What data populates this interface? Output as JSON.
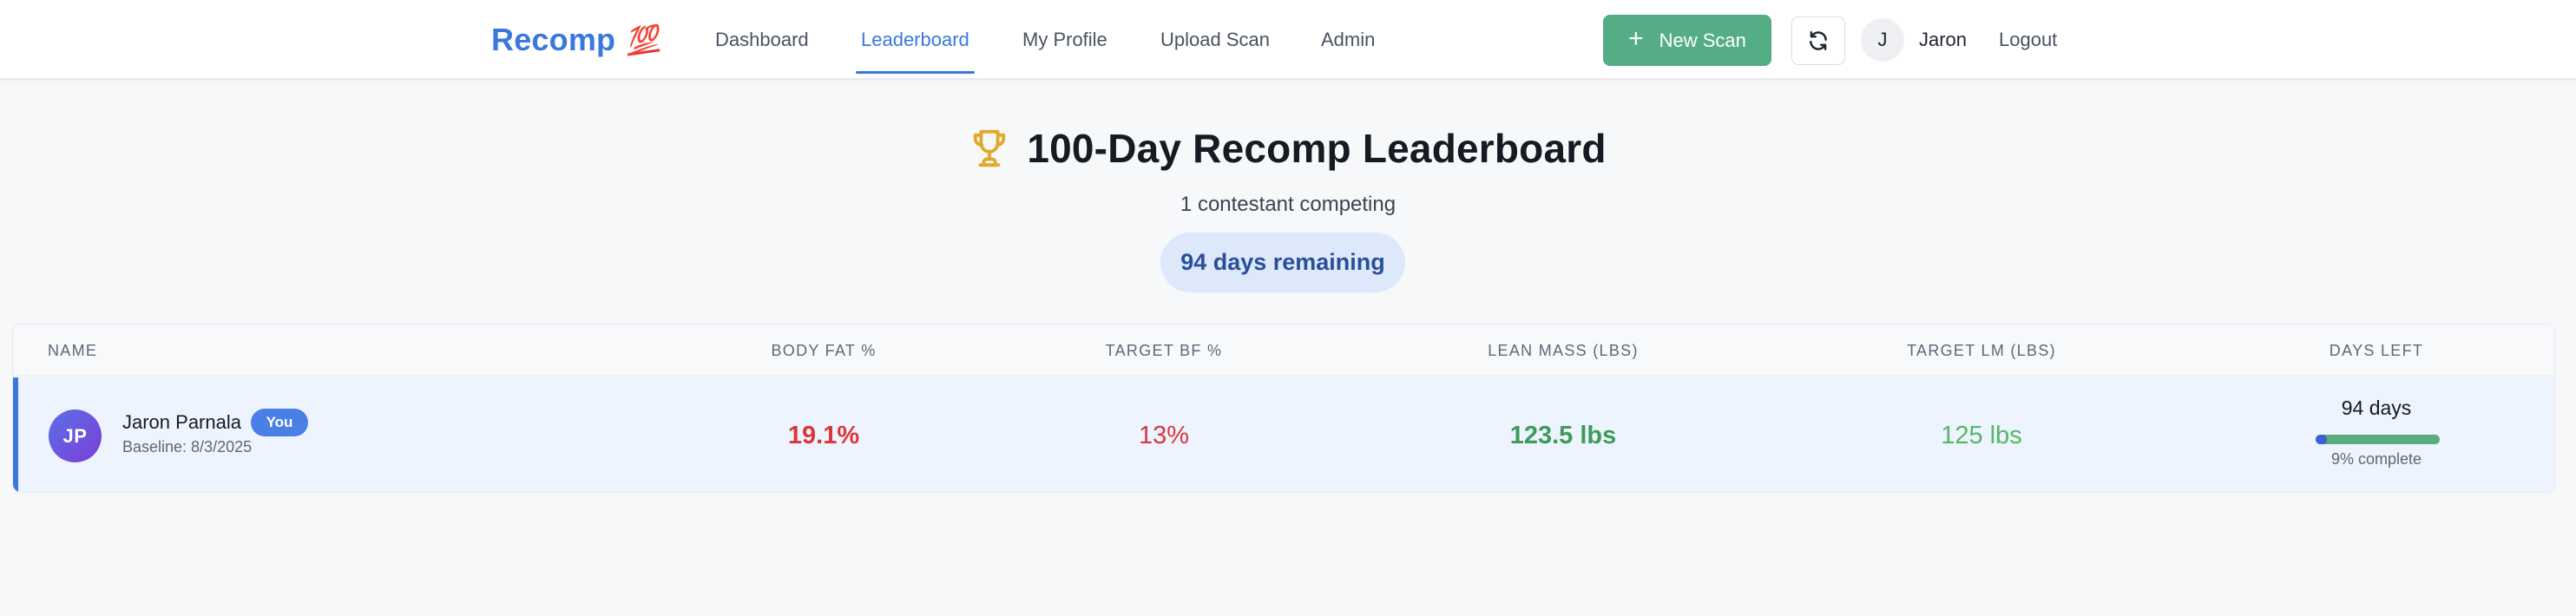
{
  "brand": {
    "name": "Recomp",
    "emoji": "💯"
  },
  "nav": {
    "items": [
      {
        "label": "Dashboard"
      },
      {
        "label": "Leaderboard",
        "active": true
      },
      {
        "label": "My Profile"
      },
      {
        "label": "Upload Scan"
      },
      {
        "label": "Admin"
      }
    ]
  },
  "header_actions": {
    "new_scan_label": "New Scan",
    "new_scan_icon": "plus-icon",
    "refresh_icon": "refresh-icon",
    "avatar_initial": "J",
    "username": "Jaron",
    "logout_label": "Logout"
  },
  "page": {
    "title_icon": "trophy-icon",
    "title": "100-Day Recomp Leaderboard",
    "subtitle": "1 contestant competing",
    "days_remaining": "94 days remaining"
  },
  "table": {
    "columns": [
      "Name",
      "Body Fat %",
      "Target BF %",
      "Lean Mass (lbs)",
      "Target LM (lbs)",
      "Days Left"
    ],
    "rows": [
      {
        "initials": "JP",
        "name": "Jaron Parnala",
        "badge": "You",
        "baseline": "Baseline: 8/3/2025",
        "body_fat": "19.1%",
        "target_bf": "13%",
        "lean_mass": "123.5 lbs",
        "target_lm": "125 lbs",
        "days_left": "94 days",
        "progress_fraction": 0.09,
        "progress_label": "9% complete"
      }
    ]
  },
  "colors": {
    "accent": "#3a78e0",
    "success": "#54ad85",
    "danger": "#d9363e",
    "trophy": "#e0a92b"
  }
}
